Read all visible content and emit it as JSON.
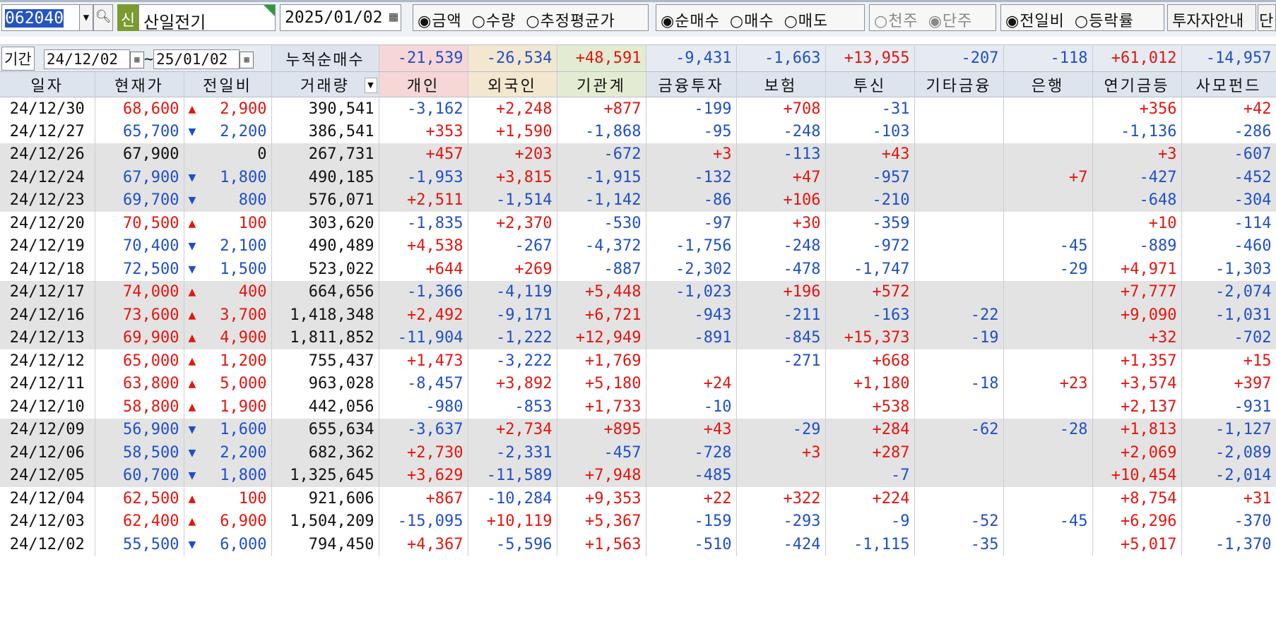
{
  "toolbar": {
    "code": "062040",
    "stock_badge": "신",
    "stock_name": "산일전기",
    "base_date": "2025/01/02",
    "value_options": [
      "◉금액",
      "○수량",
      "○추정평균가"
    ],
    "trade_options": [
      "◉순매수",
      "○매수",
      "○매도"
    ],
    "unit_options": [
      "○천주",
      "◉단주"
    ],
    "compare_options": [
      "◉전일비",
      "○등락률"
    ],
    "investor_guide_button": "투자자안내",
    "cut_button": "단"
  },
  "period": {
    "label": "기간",
    "from": "24/12/02",
    "tilde": "~",
    "to": "25/01/02",
    "cumulative_label": "누적순매수",
    "totals": [
      "-21,539",
      "-26,534",
      "+48,591",
      "-9,431",
      "-1,663",
      "+13,955",
      "-207",
      "-118",
      "+61,012",
      "-14,957"
    ]
  },
  "columns": [
    "일자",
    "현재가",
    "전일비",
    "거래량",
    "개인",
    "외국인",
    "기관계",
    "금융투자",
    "보험",
    "투신",
    "기타금융",
    "은행",
    "연기금등",
    "사모펀드"
  ],
  "rows": [
    {
      "date": "24/12/30",
      "price": "68,600",
      "dir": "up",
      "arrow": "▲",
      "chg": "2,900",
      "vol": "390,541",
      "v": [
        "-3,162",
        "+2,248",
        "+877",
        "-199",
        "+708",
        "-31",
        "",
        "",
        "+356",
        "+42"
      ]
    },
    {
      "date": "24/12/27",
      "price": "65,700",
      "dir": "dn",
      "arrow": "▼",
      "chg": "2,200",
      "vol": "386,541",
      "v": [
        "+353",
        "+1,590",
        "-1,868",
        "-95",
        "-248",
        "-103",
        "",
        "",
        "-1,136",
        "-286"
      ]
    },
    {
      "date": "24/12/26",
      "price": "67,900",
      "dir": "flat",
      "arrow": "",
      "chg": "0",
      "vol": "267,731",
      "v": [
        "+457",
        "+203",
        "-672",
        "+3",
        "-113",
        "+43",
        "",
        "",
        "+3",
        "-607"
      ]
    },
    {
      "date": "24/12/24",
      "price": "67,900",
      "dir": "dn",
      "arrow": "▼",
      "chg": "1,800",
      "vol": "490,185",
      "v": [
        "-1,953",
        "+3,815",
        "-1,915",
        "-132",
        "+47",
        "-957",
        "",
        "+7",
        "-427",
        "-452"
      ]
    },
    {
      "date": "24/12/23",
      "price": "69,700",
      "dir": "dn",
      "arrow": "▼",
      "chg": "800",
      "vol": "576,071",
      "v": [
        "+2,511",
        "-1,514",
        "-1,142",
        "-86",
        "+106",
        "-210",
        "",
        "",
        "-648",
        "-304"
      ]
    },
    {
      "date": "24/12/20",
      "price": "70,500",
      "dir": "up",
      "arrow": "▲",
      "chg": "100",
      "vol": "303,620",
      "v": [
        "-1,835",
        "+2,370",
        "-530",
        "-97",
        "+30",
        "-359",
        "",
        "",
        "+10",
        "-114"
      ]
    },
    {
      "date": "24/12/19",
      "price": "70,400",
      "dir": "dn",
      "arrow": "▼",
      "chg": "2,100",
      "vol": "490,489",
      "v": [
        "+4,538",
        "-267",
        "-4,372",
        "-1,756",
        "-248",
        "-972",
        "",
        "-45",
        "-889",
        "-460"
      ]
    },
    {
      "date": "24/12/18",
      "price": "72,500",
      "dir": "dn",
      "arrow": "▼",
      "chg": "1,500",
      "vol": "523,022",
      "v": [
        "+644",
        "+269",
        "-887",
        "-2,302",
        "-478",
        "-1,747",
        "",
        "-29",
        "+4,971",
        "-1,303"
      ]
    },
    {
      "date": "24/12/17",
      "price": "74,000",
      "dir": "up",
      "arrow": "▲",
      "chg": "400",
      "vol": "664,656",
      "v": [
        "-1,366",
        "-4,119",
        "+5,448",
        "-1,023",
        "+196",
        "+572",
        "",
        "",
        "+7,777",
        "-2,074"
      ]
    },
    {
      "date": "24/12/16",
      "price": "73,600",
      "dir": "up",
      "arrow": "▲",
      "chg": "3,700",
      "vol": "1,418,348",
      "v": [
        "+2,492",
        "-9,171",
        "+6,721",
        "-943",
        "-211",
        "-163",
        "-22",
        "",
        "+9,090",
        "-1,031"
      ]
    },
    {
      "date": "24/12/13",
      "price": "69,900",
      "dir": "up",
      "arrow": "▲",
      "chg": "4,900",
      "vol": "1,811,852",
      "v": [
        "-11,904",
        "-1,222",
        "+12,949",
        "-891",
        "-845",
        "+15,373",
        "-19",
        "",
        "+32",
        "-702"
      ]
    },
    {
      "date": "24/12/12",
      "price": "65,000",
      "dir": "up",
      "arrow": "▲",
      "chg": "1,200",
      "vol": "755,437",
      "v": [
        "+1,473",
        "-3,222",
        "+1,769",
        "",
        "-271",
        "+668",
        "",
        "",
        "+1,357",
        "+15"
      ]
    },
    {
      "date": "24/12/11",
      "price": "63,800",
      "dir": "up",
      "arrow": "▲",
      "chg": "5,000",
      "vol": "963,028",
      "v": [
        "-8,457",
        "+3,892",
        "+5,180",
        "+24",
        "",
        "+1,180",
        "-18",
        "+23",
        "+3,574",
        "+397"
      ]
    },
    {
      "date": "24/12/10",
      "price": "58,800",
      "dir": "up",
      "arrow": "▲",
      "chg": "1,900",
      "vol": "442,056",
      "v": [
        "-980",
        "-853",
        "+1,733",
        "-10",
        "",
        "+538",
        "",
        "",
        "+2,137",
        "-931"
      ]
    },
    {
      "date": "24/12/09",
      "price": "56,900",
      "dir": "dn",
      "arrow": "▼",
      "chg": "1,600",
      "vol": "655,634",
      "v": [
        "-3,637",
        "+2,734",
        "+895",
        "+43",
        "-29",
        "+284",
        "-62",
        "-28",
        "+1,813",
        "-1,127"
      ]
    },
    {
      "date": "24/12/06",
      "price": "58,500",
      "dir": "dn",
      "arrow": "▼",
      "chg": "2,200",
      "vol": "682,362",
      "v": [
        "+2,730",
        "-2,331",
        "-457",
        "-728",
        "+3",
        "+287",
        "",
        "",
        "+2,069",
        "-2,089"
      ]
    },
    {
      "date": "24/12/05",
      "price": "60,700",
      "dir": "dn",
      "arrow": "▼",
      "chg": "1,800",
      "vol": "1,325,645",
      "v": [
        "+3,629",
        "-11,589",
        "+7,948",
        "-485",
        "",
        "-7",
        "",
        "",
        "+10,454",
        "-2,014"
      ]
    },
    {
      "date": "24/12/04",
      "price": "62,500",
      "dir": "up",
      "arrow": "▲",
      "chg": "100",
      "vol": "921,606",
      "v": [
        "+867",
        "-10,284",
        "+9,353",
        "+22",
        "+322",
        "+224",
        "",
        "",
        "+8,754",
        "+31"
      ]
    },
    {
      "date": "24/12/03",
      "price": "62,400",
      "dir": "up",
      "arrow": "▲",
      "chg": "6,900",
      "vol": "1,504,209",
      "v": [
        "-15,095",
        "+10,119",
        "+5,367",
        "-159",
        "-293",
        "-9",
        "-52",
        "-45",
        "+6,296",
        "-370"
      ]
    },
    {
      "date": "24/12/02",
      "price": "55,500",
      "dir": "dn",
      "arrow": "▼",
      "chg": "6,000",
      "vol": "794,450",
      "v": [
        "+4,367",
        "-5,596",
        "+1,563",
        "-510",
        "-424",
        "-1,115",
        "-35",
        "",
        "+5,017",
        "-1,370"
      ]
    }
  ],
  "colors": {
    "up": "#e3150f",
    "down": "#1f4fc8",
    "individual_bg": "#f6d6d6",
    "foreign_bg": "#f3e7cf",
    "institution_bg": "#e3ecd2",
    "header_bg": "#dde4ee",
    "group_row_bg": "#e3e3e3"
  }
}
